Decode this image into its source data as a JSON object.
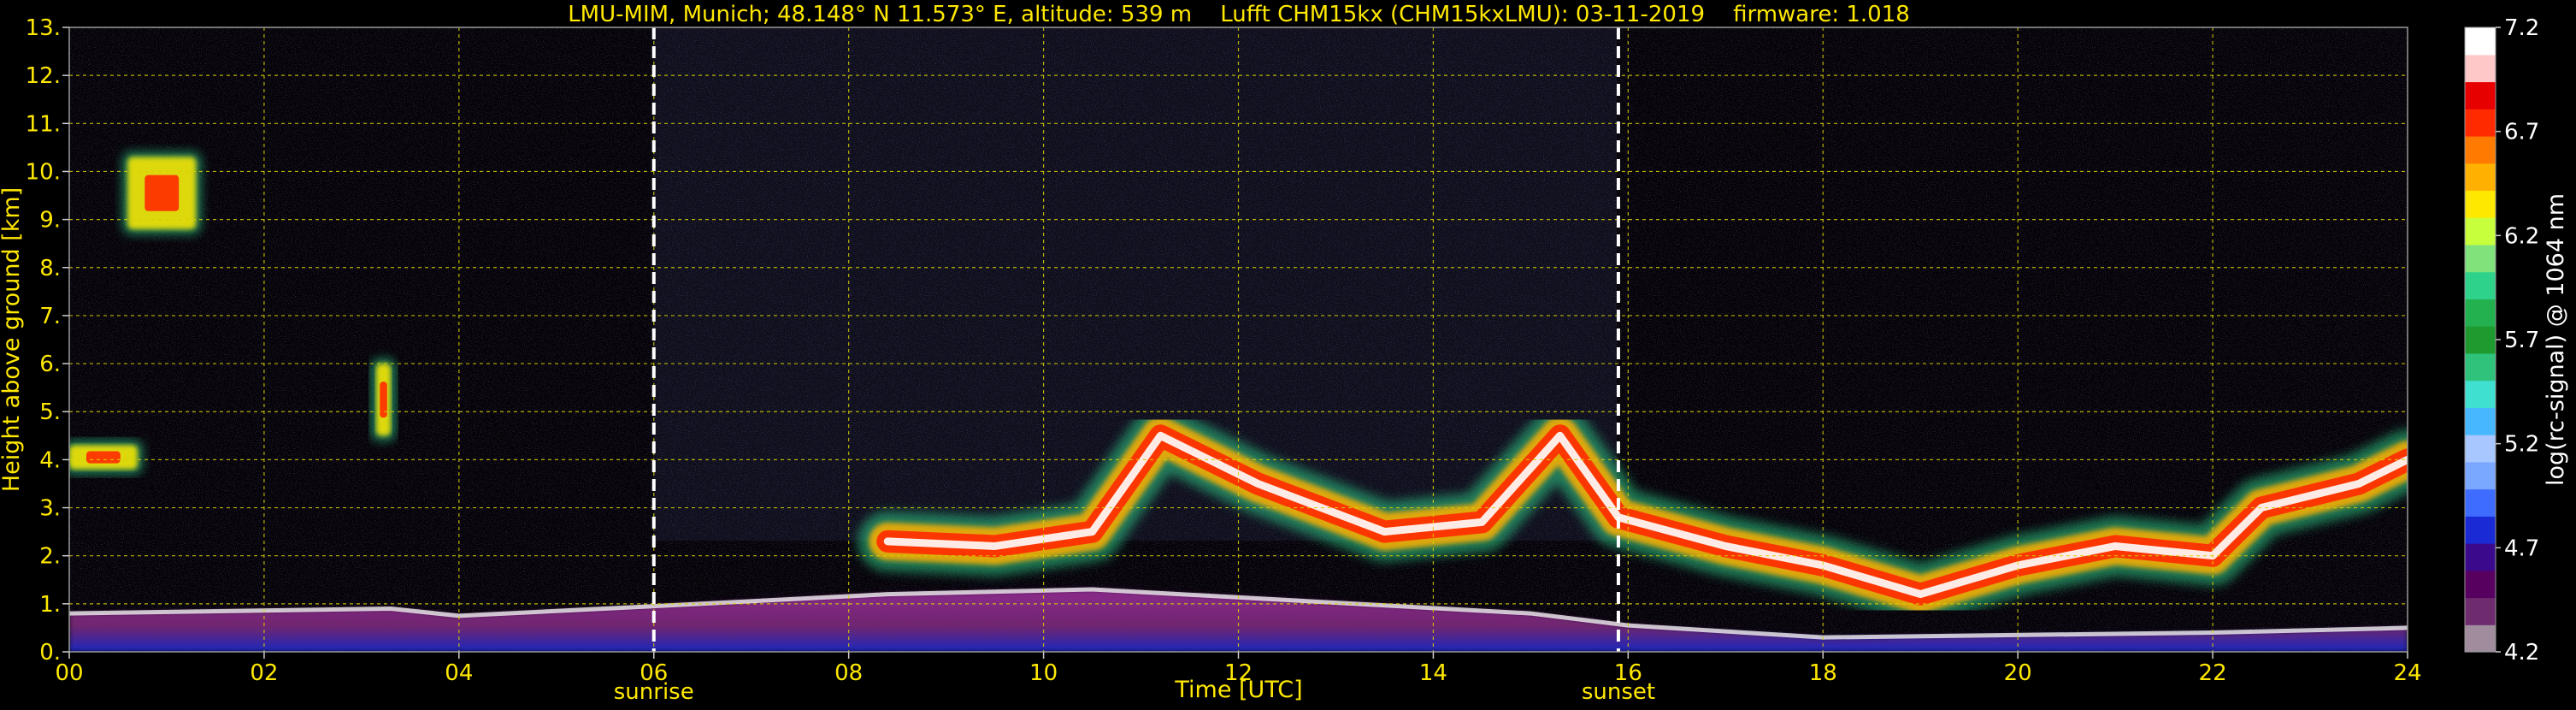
{
  "chart_data": {
    "type": "heatmap",
    "title": "LMU-MIM, Munich; 48.148° N 11.573° E, altitude: 539 m    Lufft CHM15kx (CHM15kxLMU): 03-11-2019    firmware: 1.018",
    "xlabel": "Time [UTC]",
    "ylabel": "Height above ground [km]",
    "x_ticks": [
      "00",
      "02",
      "04",
      "06",
      "08",
      "10",
      "12",
      "14",
      "16",
      "18",
      "20",
      "22",
      "24"
    ],
    "y_ticks": [
      "0.",
      "1.",
      "2.",
      "3.",
      "4.",
      "5.",
      "6.",
      "7.",
      "8.",
      "9.",
      "10.",
      "11.",
      "12.",
      "13."
    ],
    "xlim": [
      0,
      24
    ],
    "ylim": [
      0,
      13
    ],
    "grid": true,
    "annotations": [
      {
        "label": "sunrise",
        "x": 6.0
      },
      {
        "label": "sunset",
        "x": 15.9
      }
    ],
    "colorbar": {
      "label": "log(rc-signal) @ 1064 nm",
      "range": [
        4.2,
        7.2
      ],
      "ticks": [
        "7.2",
        "6.7",
        "6.2",
        "5.7",
        "5.2",
        "4.7",
        "4.2"
      ],
      "colors": [
        "#a08c9c",
        "#6e2c6e",
        "#570060",
        "#3b0a8c",
        "#1a2ad4",
        "#3d6cff",
        "#7aa7ff",
        "#a8c6ff",
        "#47b8ff",
        "#40e0d0",
        "#2ec27a",
        "#1f9a2e",
        "#23b04f",
        "#2fd28a",
        "#7fe27a",
        "#c8ff3c",
        "#ffe800",
        "#ffb000",
        "#ff7a00",
        "#ff2a00",
        "#e60000",
        "#ffc8c8",
        "#ffffff"
      ]
    },
    "features": [
      {
        "type": "boundary_layer",
        "points": [
          [
            0.0,
            0.8
          ],
          [
            3.3,
            0.9
          ],
          [
            4.0,
            0.75
          ],
          [
            6.0,
            0.95
          ],
          [
            8.4,
            1.2
          ],
          [
            10.5,
            1.3
          ],
          [
            15.0,
            0.8
          ],
          [
            16.0,
            0.55
          ],
          [
            18.0,
            0.3
          ],
          [
            22.0,
            0.4
          ],
          [
            24.0,
            0.5
          ]
        ]
      },
      {
        "type": "aerosol_layer",
        "points": [
          [
            8.4,
            2.3
          ],
          [
            9.5,
            2.2
          ],
          [
            10.5,
            2.5
          ],
          [
            11.2,
            4.5
          ],
          [
            12.2,
            3.5
          ],
          [
            13.5,
            2.5
          ],
          [
            14.5,
            2.7
          ],
          [
            15.3,
            4.5
          ],
          [
            15.9,
            2.8
          ],
          [
            17.0,
            2.2
          ],
          [
            18.0,
            1.8
          ],
          [
            19.0,
            1.2
          ],
          [
            20.0,
            1.8
          ],
          [
            21.0,
            2.2
          ],
          [
            22.0,
            2.0
          ],
          [
            22.5,
            3.0
          ],
          [
            23.5,
            3.5
          ],
          [
            24.0,
            4.0
          ]
        ]
      },
      {
        "type": "cloud",
        "x": [
          0.6,
          1.3
        ],
        "y": [
          8.8,
          10.3
        ]
      },
      {
        "type": "cloud",
        "x": [
          3.15,
          3.3
        ],
        "y": [
          4.5,
          6.0
        ]
      },
      {
        "type": "cloud",
        "x": [
          0.0,
          0.7
        ],
        "y": [
          3.8,
          4.3
        ]
      }
    ]
  }
}
